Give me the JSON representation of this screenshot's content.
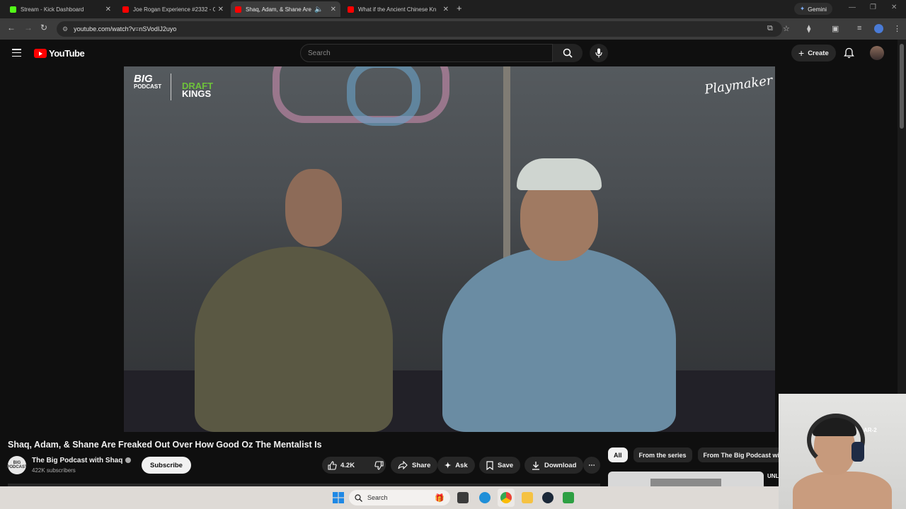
{
  "browser": {
    "tabs": [
      {
        "title": "Stream - Kick Dashboard",
        "favicon_color": "#53fc18",
        "active": false
      },
      {
        "title": "Joe Rogan Experience #2332 - C",
        "favicon_color": "#ff0000",
        "active": false
      },
      {
        "title": "Shaq, Adam, & Shane Are F",
        "favicon_color": "#ff0000",
        "active": true
      },
      {
        "title": "What if the Ancient Chinese Kn",
        "favicon_color": "#ff0000",
        "active": false
      }
    ],
    "gemini_label": "Gemini",
    "url": "youtube.com/watch?v=nSVodIJ2uyo"
  },
  "youtube": {
    "logo_text": "YouTube",
    "search_placeholder": "Search",
    "create_label": "Create",
    "video": {
      "overlay_logo_big": "BIG",
      "overlay_logo_podcast": "PODCAST",
      "overlay_logo_draft": "DRAFT",
      "overlay_logo_kings": "KINGS",
      "overlay_logo_playmaker": "Playmaker",
      "title": "Shaq, Adam, & Shane Are Freaked Out Over How Good Oz The Mentalist Is"
    },
    "channel": {
      "avatar_text": "BIG PODCAST",
      "name": "The Big Podcast with Shaq",
      "subscribers": "422K subscribers",
      "subscribe_label": "Subscribe"
    },
    "actions": {
      "like_count": "4.2K",
      "share_label": "Share",
      "ask_label": "Ask",
      "save_label": "Save",
      "download_label": "Download"
    },
    "chips": [
      "All",
      "From the series",
      "From The Big Podcast with Shaq"
    ],
    "next_up_text": "UNLOCKIN PASSWO"
  },
  "webcam": {
    "headset_text": "AR-2"
  },
  "taskbar": {
    "search_placeholder": "Search"
  }
}
